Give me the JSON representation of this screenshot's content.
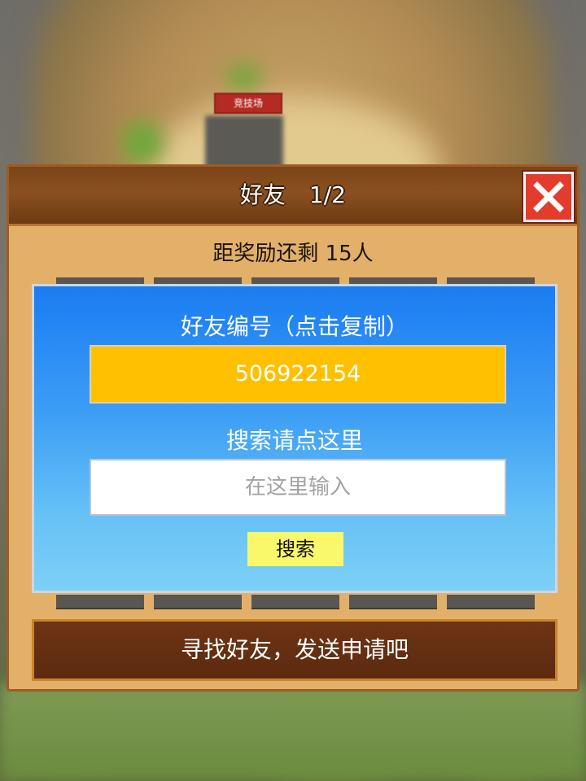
{
  "background": {
    "arena_sign": "竞技场"
  },
  "dialog": {
    "title": "好友",
    "page": "1/2",
    "reward_text": "距奖励还剩 15人",
    "friend_id_label": "好友编号（点击复制）",
    "friend_id": "506922154",
    "search_label": "搜索请点这里",
    "search_placeholder": "在这里输入",
    "search_button": "搜索",
    "bottom_button": "寻找好友，发送申请吧"
  },
  "icons": {
    "close": "close-icon",
    "prev": "arrow-left-icon",
    "next": "arrow-right-icon"
  },
  "colors": {
    "id_box": "#fec000",
    "search_button": "#f9f86a",
    "close_button": "#e33c2c",
    "panel": "#3b9cf5"
  }
}
